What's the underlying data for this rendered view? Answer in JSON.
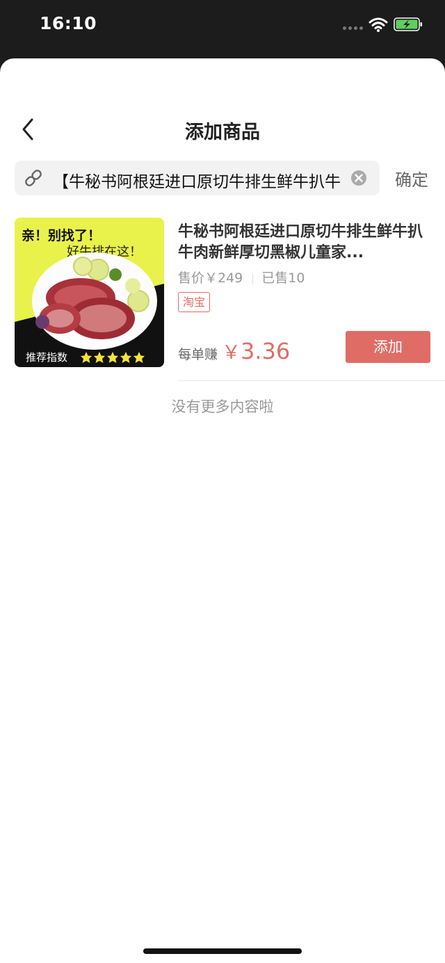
{
  "status_bar": {
    "time": "16:10"
  },
  "header": {
    "title": "添加商品"
  },
  "search": {
    "value": "【牛秘书阿根廷进口原切牛排生鲜牛扒牛",
    "confirm_label": "确定"
  },
  "product": {
    "image": {
      "headline": "亲！别找了！",
      "subline": "好牛排在这！",
      "rating_label": "推荐指数",
      "stars": 5
    },
    "title": "牛秘书阿根廷进口原切牛排生鲜牛扒牛肉新鲜厚切黑椒儿童家...",
    "price_text": "售价￥249",
    "sold_text": "已售10",
    "platform_tag": "淘宝",
    "earn_label": "每单赚",
    "earn_currency": "￥",
    "earn_value": "3.36",
    "add_label": "添加"
  },
  "footer": {
    "no_more": "没有更多内容啦"
  },
  "colors": {
    "accent": "#e06c66",
    "status_bar_bg": "#1c1c1c",
    "thumb_yellow": "#e9f24a"
  },
  "icons": [
    "back-chevron-icon",
    "link-icon",
    "clear-icon",
    "wifi-icon",
    "battery-charging-icon",
    "signal-icon",
    "star-icon"
  ]
}
